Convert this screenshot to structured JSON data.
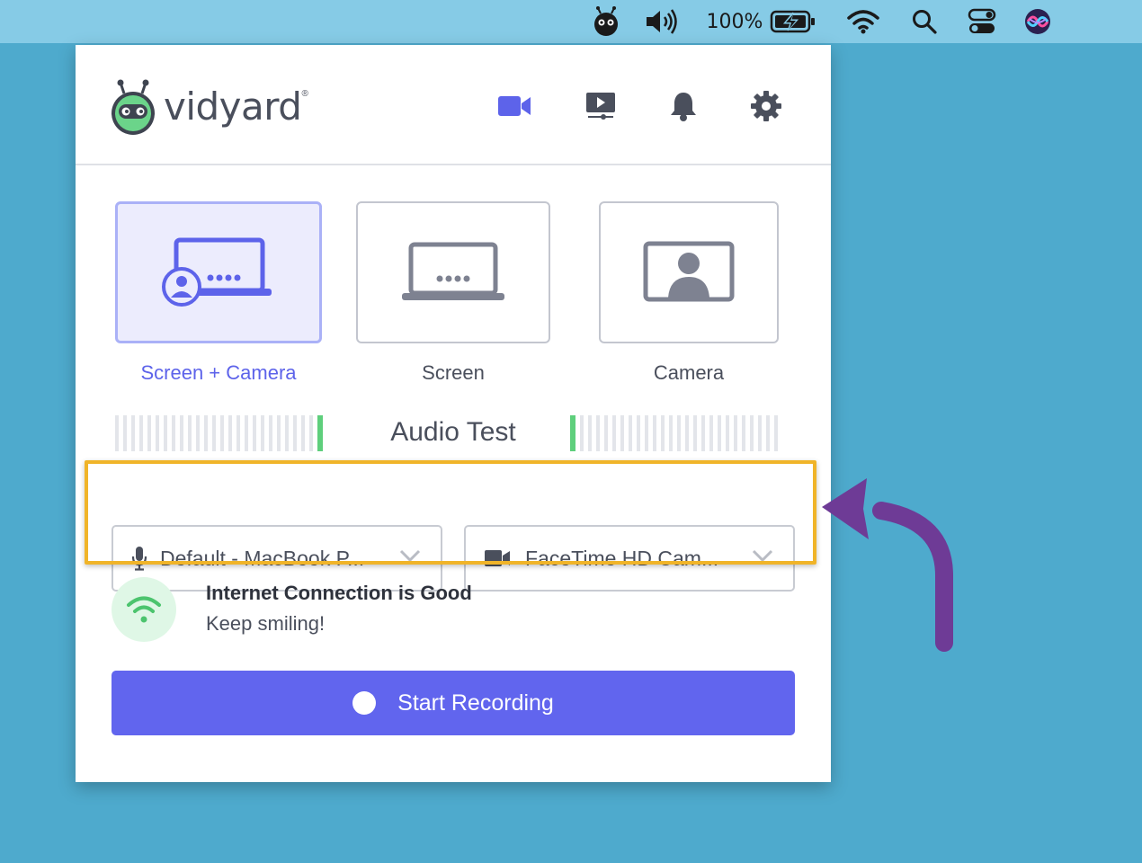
{
  "menubar": {
    "battery_text": "100%",
    "icons": [
      "vidyard-menubar-icon",
      "volume-icon",
      "battery-charging-icon",
      "wifi-icon",
      "search-icon",
      "control-center-icon",
      "siri-icon"
    ]
  },
  "header": {
    "brand_name": "vidyard",
    "brand_reg": "®",
    "nav_icons": [
      "video-camera-icon",
      "screen-player-icon",
      "bell-icon",
      "gear-icon"
    ],
    "active_color": "#5d63ea"
  },
  "modes": {
    "items": [
      {
        "label": "Screen + Camera",
        "icon": "screen-camera-icon",
        "active": true
      },
      {
        "label": "Screen",
        "icon": "laptop-screen-icon",
        "active": false
      },
      {
        "label": "Camera",
        "icon": "camera-user-icon",
        "active": false
      }
    ]
  },
  "audio_test": {
    "title": "Audio Test"
  },
  "devices": {
    "microphone": {
      "value": "Default - MacBook P...",
      "icon": "microphone-icon"
    },
    "camera": {
      "value": "FaceTime HD Cam...",
      "icon": "video-camera-icon"
    }
  },
  "connection": {
    "title": "Internet Connection is Good",
    "subtitle": "Keep smiling!"
  },
  "actions": {
    "start_label": "Start Recording",
    "button_color": "#6165ee"
  }
}
